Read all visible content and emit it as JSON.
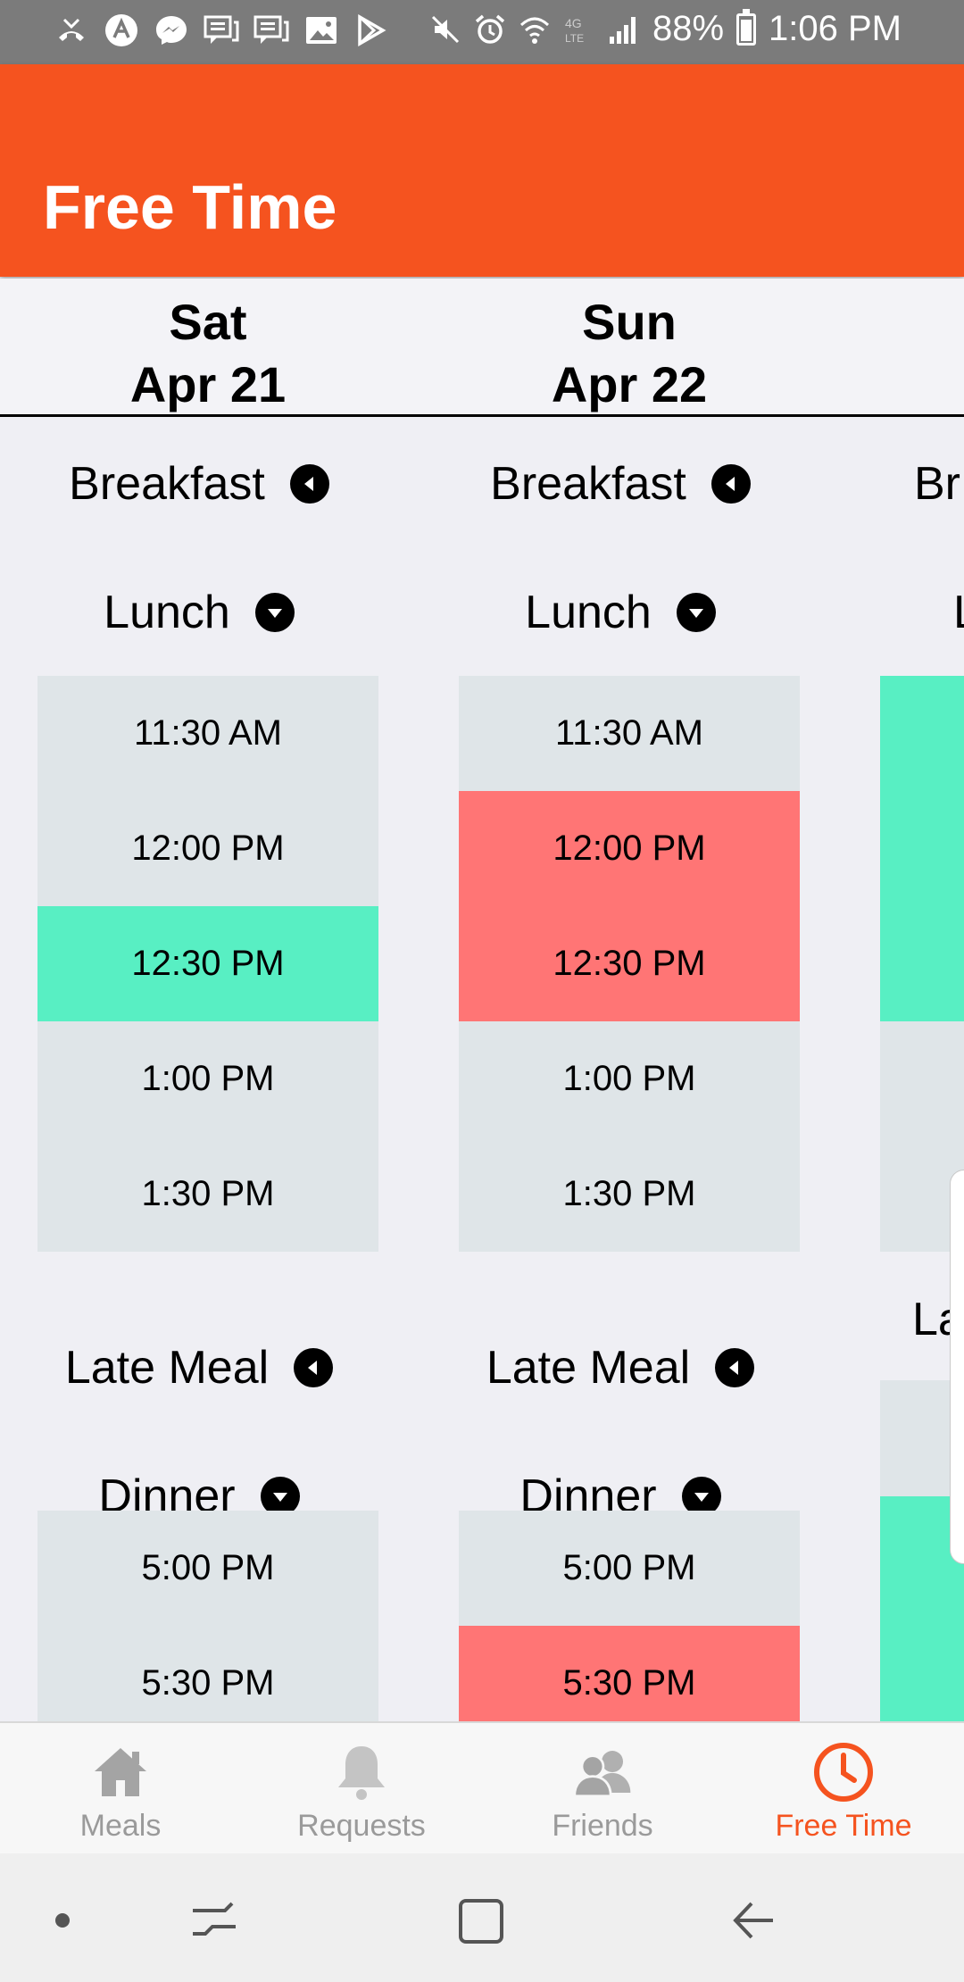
{
  "status_bar": {
    "battery": "88%",
    "time": "1:06 PM",
    "left_icons": [
      "missed-call-icon",
      "app-icon",
      "messenger-icon",
      "chat-icon",
      "chat-icon",
      "image-icon",
      "play-store-icon"
    ],
    "right_icons": [
      "mute-icon",
      "alarm-icon",
      "wifi-icon",
      "lte-icon",
      "signal-icon"
    ]
  },
  "app_bar": {
    "title": "Free Time"
  },
  "days": [
    {
      "weekday": "Sat",
      "date": "Apr 21",
      "breakfast_label": "Breakfast",
      "lunch_label": "Lunch",
      "lunch_slots": [
        {
          "time": "11:30 AM",
          "status": "none"
        },
        {
          "time": "12:00 PM",
          "status": "none"
        },
        {
          "time": "12:30 PM",
          "status": "free"
        },
        {
          "time": "1:00 PM",
          "status": "none"
        },
        {
          "time": "1:30 PM",
          "status": "none"
        }
      ],
      "late_meal_label": "Late Meal",
      "dinner_label": "Dinner",
      "dinner_slots": [
        {
          "time": "5:00 PM",
          "status": "none"
        },
        {
          "time": "5:30 PM",
          "status": "none"
        }
      ]
    },
    {
      "weekday": "Sun",
      "date": "Apr 22",
      "breakfast_label": "Breakfast",
      "lunch_label": "Lunch",
      "lunch_slots": [
        {
          "time": "11:30 AM",
          "status": "none"
        },
        {
          "time": "12:00 PM",
          "status": "busy"
        },
        {
          "time": "12:30 PM",
          "status": "busy"
        },
        {
          "time": "1:00 PM",
          "status": "none"
        },
        {
          "time": "1:30 PM",
          "status": "none"
        }
      ],
      "late_meal_label": "Late Meal",
      "dinner_label": "Dinner",
      "dinner_slots": [
        {
          "time": "5:00 PM",
          "status": "none"
        },
        {
          "time": "5:30 PM",
          "status": "busy"
        }
      ]
    }
  ],
  "partial_column": {
    "breakfast_fragment": "Br",
    "lunch_fragment": "L",
    "late_meal_fragment": "La"
  },
  "colors": {
    "accent": "#f5531f",
    "free": "#58efc3",
    "busy": "#ff7575",
    "none": "#dfe5e8",
    "inactive": "#9a9a9a"
  },
  "bottom_nav": [
    {
      "label": "Meals",
      "icon": "home-icon",
      "active": false
    },
    {
      "label": "Requests",
      "icon": "bell-icon",
      "active": false
    },
    {
      "label": "Friends",
      "icon": "friends-icon",
      "active": false
    },
    {
      "label": "Free Time",
      "icon": "clock-icon",
      "active": true
    }
  ],
  "system_nav": [
    "dot-icon",
    "recent-apps-icon",
    "home-button-icon",
    "back-icon"
  ]
}
